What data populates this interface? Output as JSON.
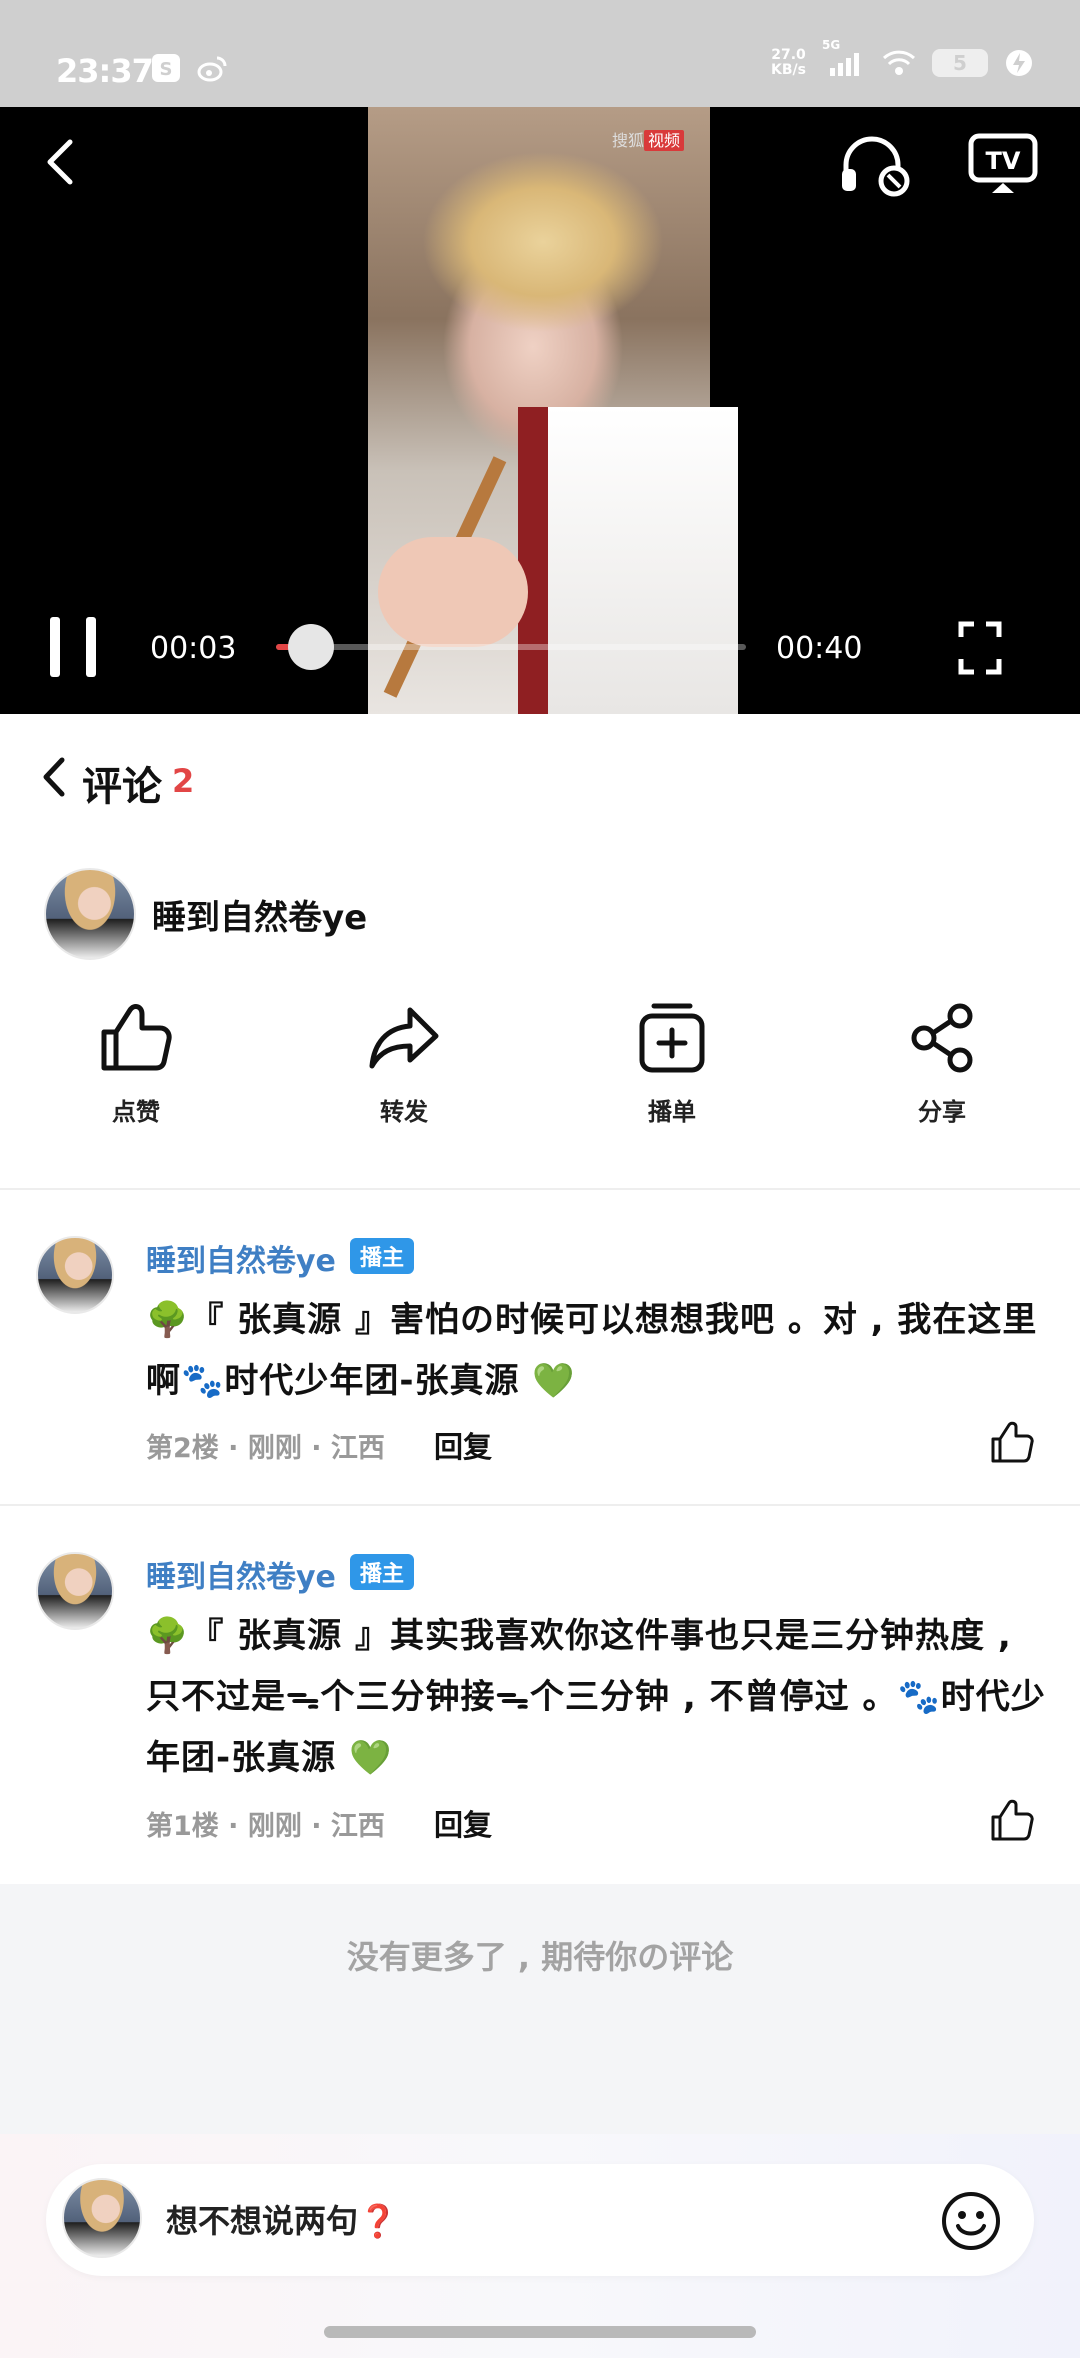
{
  "status_bar": {
    "time": "23:37",
    "icons": [
      "sogou-icon",
      "weibo-icon"
    ],
    "net_speed_value": "27.0",
    "net_speed_unit": "KB/s",
    "network": "5G",
    "battery": "5"
  },
  "video": {
    "watermark_brand": "搜狐",
    "watermark_tag": "视频",
    "current_time": "00:03",
    "total_time": "00:40",
    "progress_fraction": 0.075
  },
  "comments_header": {
    "title": "评论",
    "count": "2"
  },
  "author": {
    "name": "睡到自然卷ye"
  },
  "actions": [
    {
      "id": "like",
      "label": "点赞",
      "icon": "thumbs-up-icon"
    },
    {
      "id": "forward",
      "label": "转发",
      "icon": "share-arrow-icon"
    },
    {
      "id": "playlist",
      "label": "播单",
      "icon": "playlist-add-icon"
    },
    {
      "id": "share",
      "label": "分享",
      "icon": "share-nodes-icon"
    }
  ],
  "comments": [
    {
      "user": "睡到自然卷ye",
      "badge": "播主",
      "text": "🌳『 张真源 』害怕の时候可以想想我吧 。对 , 我在这里啊🐾时代少年团-张真源 💚",
      "meta": "第2楼 · 刚刚 · 江西",
      "reply": "回复"
    },
    {
      "user": "睡到自然卷ye",
      "badge": "播主",
      "text": "🌳『 张真源 』其实我喜欢你这件事也只是三分钟热度 , 只不过是ᯓ个三分钟接ᯓ个三分钟 , 不曾停过 。🐾时代少年团-张真源 💚",
      "meta": "第1楼 · 刚刚 · 江西",
      "reply": "回复"
    }
  ],
  "no_more_text": "没有更多了 , 期待你の评论",
  "input": {
    "placeholder": "想不想说两句❓"
  }
}
